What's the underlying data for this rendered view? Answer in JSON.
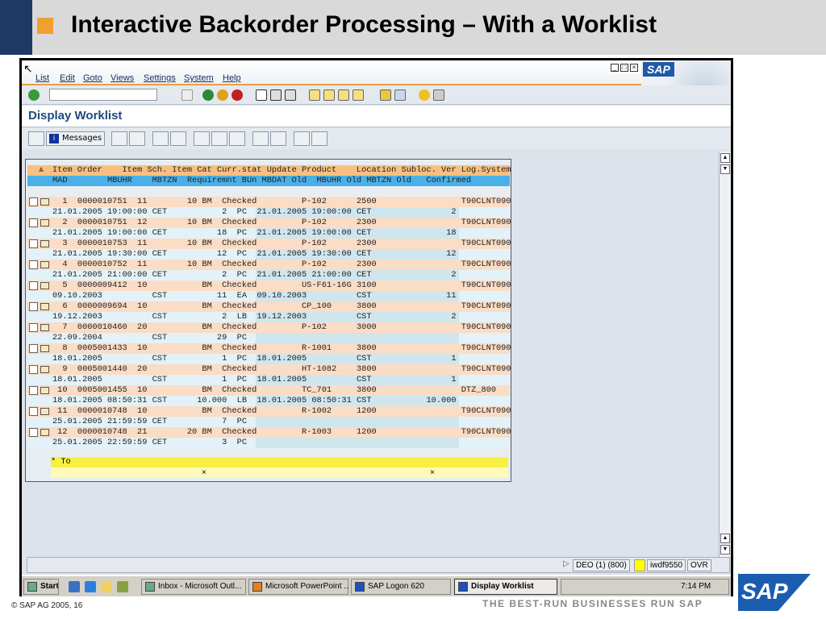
{
  "slide": {
    "title": "Interactive Backorder Processing – With a Worklist",
    "copyright": "© SAP AG 2005, 16",
    "slogan": "THE BEST-RUN BUSINESSES RUN SAP",
    "logo": "SAP"
  },
  "menu": [
    "List",
    "Edit",
    "Goto",
    "Views",
    "Settings",
    "System",
    "Help"
  ],
  "screen_title": "Display Worklist",
  "toolbar": {
    "messages_label": "Messages"
  },
  "header": {
    "line1": "Item Order    Item Sch. Item Cat Curr.stat Update Product    Location Subloc. Ver Log.System",
    "line2": "MAD        MBUHR    MBTZN  Requiremnt BUn MBDAT Old  MBUHR Old MBTZN Old   Confirmed"
  },
  "rows": [
    {
      "n": "1",
      "order": "0000010751",
      "item": "11",
      "sch": "10",
      "cat": "BM",
      "stat": "Checked",
      "product": "P-102",
      "loc": "2500",
      "log": "T90CLNT090",
      "mad": "21.01.2005 19:00:00 CET",
      "req": "2",
      "bun": "PC",
      "mbdat": "21.01.2005 19:00:00",
      "tz": "CET",
      "conf": "2"
    },
    {
      "n": "2",
      "order": "0000010751",
      "item": "12",
      "sch": "10",
      "cat": "BM",
      "stat": "Checked",
      "product": "P-102",
      "loc": "2300",
      "log": "T90CLNT090",
      "mad": "21.01.2005 19:00:00 CET",
      "req": "18",
      "bun": "PC",
      "mbdat": "21.01.2005 19:00:00",
      "tz": "CET",
      "conf": "18"
    },
    {
      "n": "3",
      "order": "0000010753",
      "item": "11",
      "sch": "10",
      "cat": "BM",
      "stat": "Checked",
      "product": "P-102",
      "loc": "2300",
      "log": "T90CLNT090",
      "mad": "21.01.2005 19:30:00 CET",
      "req": "12",
      "bun": "PC",
      "mbdat": "21.01.2005 19:30:00",
      "tz": "CET",
      "conf": "12"
    },
    {
      "n": "4",
      "order": "0000010752",
      "item": "11",
      "sch": "10",
      "cat": "BM",
      "stat": "Checked",
      "product": "P-102",
      "loc": "2300",
      "log": "T90CLNT090",
      "mad": "21.01.2005 21:00:00 CET",
      "req": "2",
      "bun": "PC",
      "mbdat": "21.01.2005 21:00:00",
      "tz": "CET",
      "conf": "2"
    },
    {
      "n": "5",
      "order": "0000009412",
      "item": "10",
      "sch": "",
      "cat": "BM",
      "stat": "Checked",
      "product": "US-F61-16G",
      "loc": "3100",
      "log": "T90CLNT090",
      "mad": "09.10.2003          CST",
      "req": "11",
      "bun": "EA",
      "mbdat": "09.10.2003",
      "tz": "CST",
      "conf": "11"
    },
    {
      "n": "6",
      "order": "0000009694",
      "item": "10",
      "sch": "",
      "cat": "BM",
      "stat": "Checked",
      "product": "CP_100",
      "loc": "3800",
      "log": "T90CLNT090",
      "mad": "19.12.2003          CST",
      "req": "2",
      "bun": "LB",
      "mbdat": "19.12.2003",
      "tz": "CST",
      "conf": "2"
    },
    {
      "n": "7",
      "order": "0000010460",
      "item": "20",
      "sch": "",
      "cat": "BM",
      "stat": "Checked",
      "product": "P-102",
      "loc": "3000",
      "log": "T90CLNT090",
      "mad": "22.09.2004          CST",
      "req": "29",
      "bun": "PC",
      "mbdat": "",
      "tz": "",
      "conf": ""
    },
    {
      "n": "8",
      "order": "0005001433",
      "item": "10",
      "sch": "",
      "cat": "BM",
      "stat": "Checked",
      "product": "R-1001",
      "loc": "3800",
      "log": "T90CLNT090",
      "mad": "18.01.2005          CST",
      "req": "1",
      "bun": "PC",
      "mbdat": "18.01.2005",
      "tz": "CST",
      "conf": "1"
    },
    {
      "n": "9",
      "order": "0005001440",
      "item": "20",
      "sch": "",
      "cat": "BM",
      "stat": "Checked",
      "product": "HT-1082",
      "loc": "3800",
      "log": "T90CLNT090",
      "mad": "18.01.2005          CST",
      "req": "1",
      "bun": "PC",
      "mbdat": "18.01.2005",
      "tz": "CST",
      "conf": "1"
    },
    {
      "n": "10",
      "order": "0005001455",
      "item": "10",
      "sch": "",
      "cat": "BM",
      "stat": "Checked",
      "product": "TC_701",
      "loc": "3800",
      "log": "DTZ_800",
      "mad": "18.01.2005 08:50:31 CST",
      "req": "10.000",
      "bun": "LB",
      "mbdat": "18.01.2005 08:50:31",
      "tz": "CST",
      "conf": "10.000"
    },
    {
      "n": "11",
      "order": "0000010748",
      "item": "10",
      "sch": "",
      "cat": "BM",
      "stat": "Checked",
      "product": "R-1002",
      "loc": "1200",
      "log": "T90CLNT090",
      "mad": "25.01.2005 21:59:59 CET",
      "req": "7",
      "bun": "PC",
      "mbdat": "",
      "tz": "",
      "conf": ""
    },
    {
      "n": "12",
      "order": "0000010748",
      "item": "21",
      "sch": "20",
      "cat": "BM",
      "stat": "Checked",
      "product": "R-1003",
      "loc": "1200",
      "log": "T90CLNT090",
      "mad": "25.01.2005 22:59:59 CET",
      "req": "3",
      "bun": "PC",
      "mbdat": "",
      "tz": "",
      "conf": ""
    }
  ],
  "totals": {
    "label": "* To",
    "mark": "×"
  },
  "status": {
    "system": "DEO (1) (800)",
    "server": "iwdf9550",
    "mode": "OVR"
  },
  "taskbar": {
    "start": "Start",
    "tasks": [
      "Inbox - Microsoft Outl...",
      "Microsoft PowerPoint ...",
      "SAP Logon 620",
      "Display Worklist"
    ],
    "clock": "7:14 PM"
  }
}
